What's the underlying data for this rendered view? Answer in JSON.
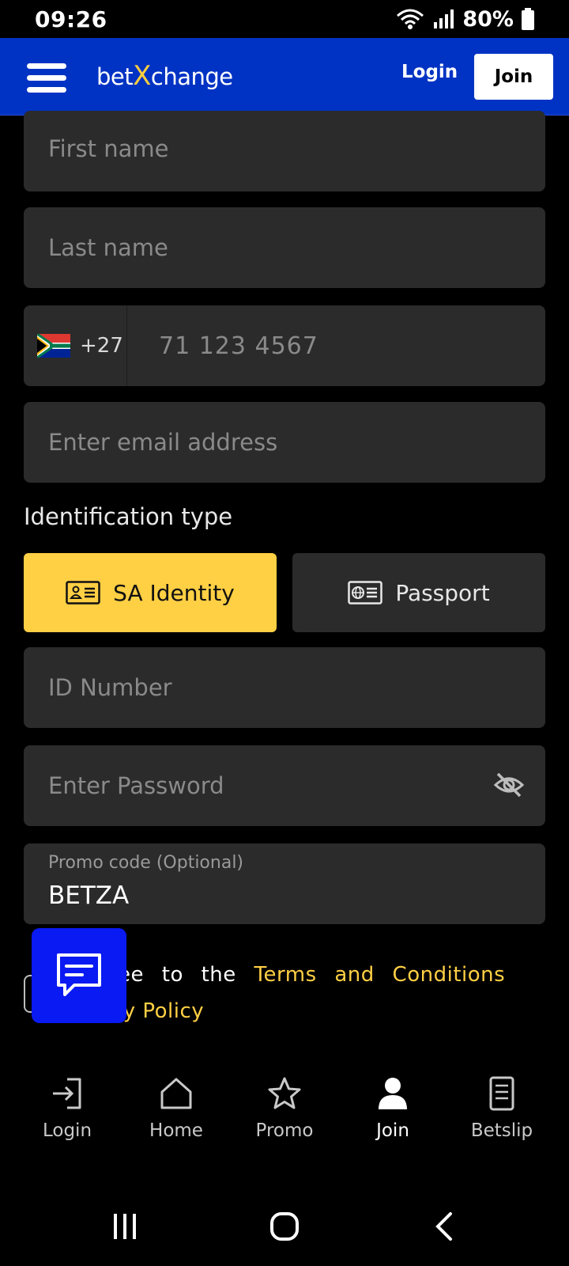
{
  "status_bar": {
    "time": "09:26",
    "battery": "80%"
  },
  "header": {
    "logo_prefix": "bet",
    "logo_x": "X",
    "logo_suffix": "change",
    "login_label": "Login",
    "join_label": "Join"
  },
  "form": {
    "first_name_placeholder": "First name",
    "last_name_placeholder": "Last name",
    "phone_code": "+27",
    "phone_placeholder": "71 123 4567",
    "email_placeholder": "Enter email address",
    "id_section_label": "Identification type",
    "id_options": [
      {
        "label": "SA Identity",
        "selected": true
      },
      {
        "label": "Passport",
        "selected": false
      }
    ],
    "id_number_placeholder": "ID Number",
    "password_placeholder": "Enter Password",
    "promo_label": "Promo code (Optional)",
    "promo_value": "BETZA"
  },
  "terms": {
    "prefix": "I agree to the",
    "link1": "Terms and Conditions",
    "conj": "and",
    "link2": "Privacy Policy"
  },
  "bottom_nav": [
    {
      "label": "Login",
      "icon": "login-icon"
    },
    {
      "label": "Home",
      "icon": "home-icon"
    },
    {
      "label": "Promo",
      "icon": "star-icon"
    },
    {
      "label": "Join",
      "icon": "user-icon",
      "active": true
    },
    {
      "label": "Betslip",
      "icon": "betslip-icon"
    }
  ],
  "colors": {
    "header_bg": "#0033c4",
    "accent_yellow": "#ffcf44",
    "field_bg": "#2b2b2b",
    "chat_bg": "#0a1af2"
  }
}
